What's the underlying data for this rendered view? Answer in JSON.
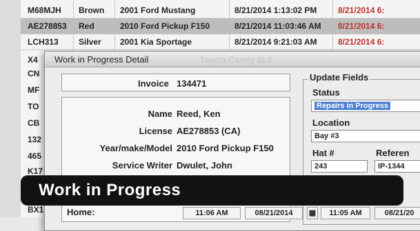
{
  "grid_rows": [
    {
      "col1": "M68MJH",
      "col2": "Brown",
      "col3": "2001 Ford Mustang",
      "col4": "8/21/2014 1:13:02 PM",
      "col5": "8/21/2014 6:",
      "selected": false
    },
    {
      "col1": "AE278853",
      "col2": "Red",
      "col3": "2010 Ford Pickup F150",
      "col4": "8/21/2014 11:03:46 AM",
      "col5": "8/21/2014 6:",
      "selected": true
    },
    {
      "col1": "LCH313",
      "col2": "Silver",
      "col3": "2001 Kia Sportage",
      "col4": "8/21/2014 9:21:03 AM",
      "col5": "8/21/2014 6:",
      "selected": false
    }
  ],
  "left_column": [
    "X4",
    "CN",
    "MF",
    "TO",
    "CB",
    "132",
    "465",
    "K17",
    "BX1"
  ],
  "dialog": {
    "title": "Work in Progress Detail",
    "ghost_text": "Toyota Camry XLE",
    "invoice_label": "Invoice",
    "invoice_value": "134471",
    "name_label": "Name",
    "name_value": "Reed, Ken",
    "license_label": "License",
    "license_value": "AE278853 (CA)",
    "ymm_label": "Year/make/Model",
    "ymm_value": "2010 Ford Pickup F150",
    "writer_label": "Service Writer",
    "writer_value": "Dwulet, John",
    "update_group_label": "Update Fields",
    "status_label": "Status",
    "status_value": "Repairs in Progress",
    "location_label": "Location",
    "location_value": "Bay #3",
    "hat_label": "Hat #",
    "hat_value": "243",
    "reference_label": "Referen",
    "reference_value": "IP-1344",
    "home_label": "Home:",
    "time1": "11:06 AM",
    "date1": "08/21/2014",
    "time2": "11:05 AM",
    "date2": "08/21/20"
  },
  "banner": {
    "text": "Work in Progress"
  }
}
